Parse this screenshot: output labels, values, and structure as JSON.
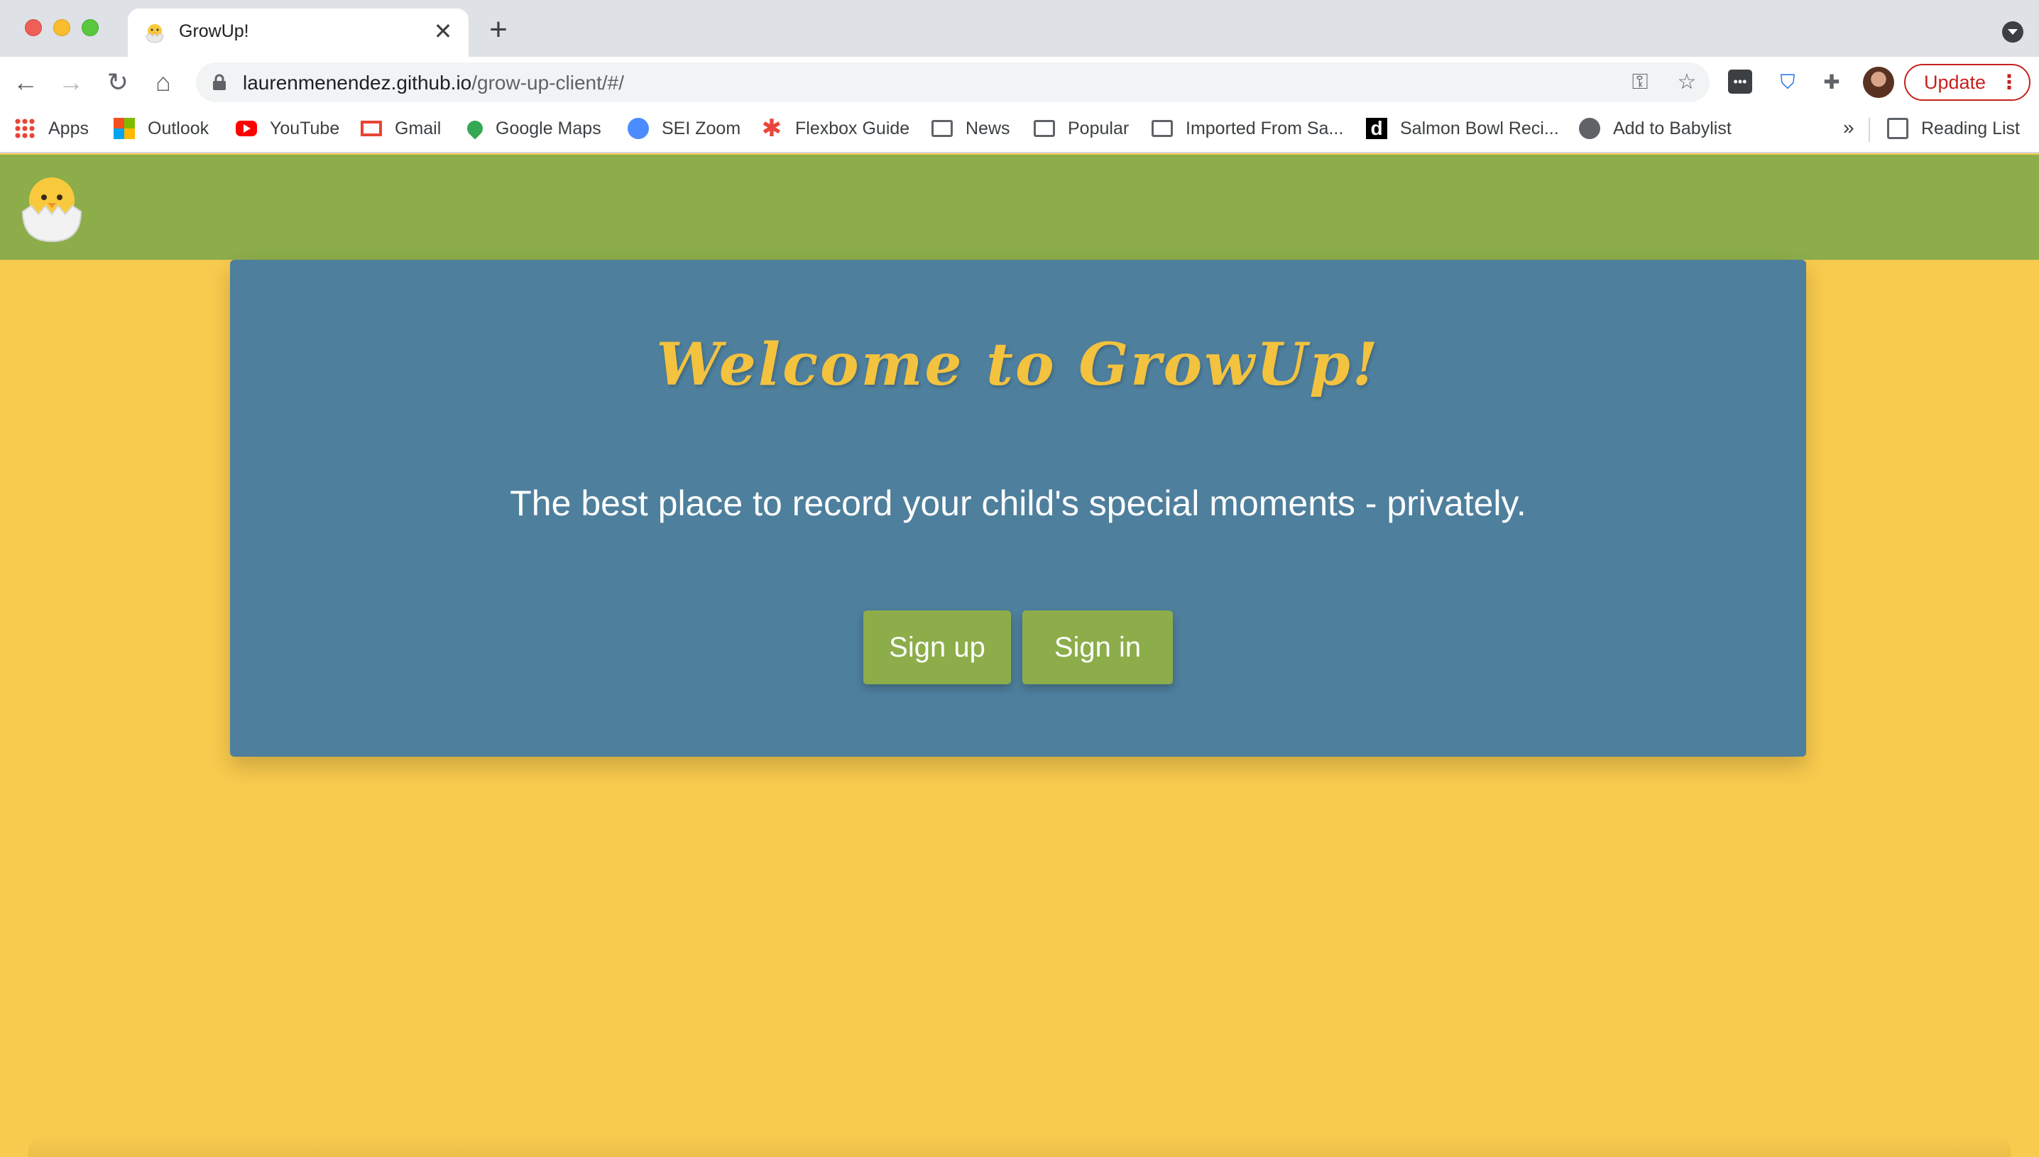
{
  "browser": {
    "tab_title": "GrowUp!",
    "url_domain": "laurenmenendez.github.io",
    "url_path": "/grow-up-client/#/",
    "update_label": "Update",
    "bookmarks": [
      {
        "label": "Apps",
        "icon": "apps-grid-icon"
      },
      {
        "label": "Outlook",
        "icon": "outlook-icon"
      },
      {
        "label": "YouTube",
        "icon": "youtube-icon"
      },
      {
        "label": "Gmail",
        "icon": "gmail-icon"
      },
      {
        "label": "Google Maps",
        "icon": "maps-pin-icon"
      },
      {
        "label": "SEI Zoom",
        "icon": "zoom-icon"
      },
      {
        "label": "Flexbox Guide",
        "icon": "asterisk-icon"
      },
      {
        "label": "News",
        "icon": "folder-icon"
      },
      {
        "label": "Popular",
        "icon": "folder-icon"
      },
      {
        "label": "Imported From Sa...",
        "icon": "folder-icon"
      },
      {
        "label": "Salmon Bowl Reci...",
        "icon": "d-logo-icon"
      },
      {
        "label": "Add to Babylist",
        "icon": "globe-icon"
      }
    ],
    "bookmarks_overflow": "»",
    "reading_list_label": "Reading List"
  },
  "page": {
    "title": "Welcome to GrowUp!",
    "subtitle": "The best place to record your child's special moments - privately.",
    "signup_label": "Sign up",
    "signin_label": "Sign in"
  },
  "colors": {
    "header_green": "#8cad4a",
    "background_yellow": "#f8ca4d",
    "card_blue": "#4e7f9d",
    "title_yellow": "#f3c23f"
  }
}
